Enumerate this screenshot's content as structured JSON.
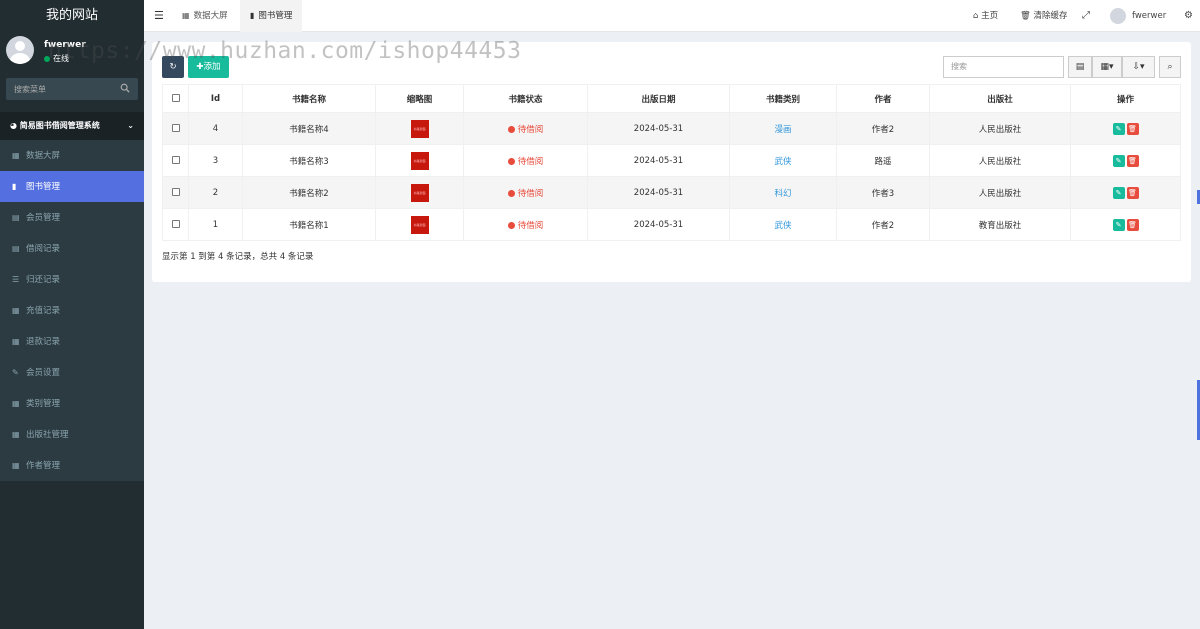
{
  "site": {
    "title": "我的网站"
  },
  "user": {
    "name": "fwerwer",
    "status": "在线"
  },
  "sidebar": {
    "search_placeholder": "搜索菜单",
    "system_name": "简易图书借阅管理系统",
    "items": [
      {
        "label": "数据大屏",
        "icon": "table-icon",
        "active": false
      },
      {
        "label": "图书管理",
        "icon": "book-icon",
        "active": true
      },
      {
        "label": "会员管理",
        "icon": "table-icon",
        "active": false
      },
      {
        "label": "借阅记录",
        "icon": "table-icon",
        "active": false
      },
      {
        "label": "归还记录",
        "icon": "list-icon",
        "active": false
      },
      {
        "label": "充值记录",
        "icon": "table-icon",
        "active": false
      },
      {
        "label": "退款记录",
        "icon": "table-icon",
        "active": false
      },
      {
        "label": "会员设置",
        "icon": "edit-icon",
        "active": false
      },
      {
        "label": "类别管理",
        "icon": "table-icon",
        "active": false
      },
      {
        "label": "出版社管理",
        "icon": "table-icon",
        "active": false
      },
      {
        "label": "作者管理",
        "icon": "table-icon",
        "active": false
      }
    ]
  },
  "topbar": {
    "tabs": [
      {
        "label": "数据大屏",
        "active": false
      },
      {
        "label": "图书管理",
        "active": true
      }
    ],
    "home_label": "主页",
    "clear_cache_label": "清除缓存",
    "username": "fwerwer"
  },
  "toolbar": {
    "add_label": "添加",
    "search_placeholder": "搜索"
  },
  "table": {
    "headers": [
      "Id",
      "书籍名称",
      "缩略图",
      "书籍状态",
      "出版日期",
      "书籍类别",
      "作者",
      "出版社",
      "操作"
    ],
    "cover_text": "书籍封面",
    "rows": [
      {
        "id": "4",
        "name": "书籍名称4",
        "status": "待借阅",
        "date": "2024-05-31",
        "category": "漫画",
        "author": "作者2",
        "publisher": "人民出版社"
      },
      {
        "id": "3",
        "name": "书籍名称3",
        "status": "待借阅",
        "date": "2024-05-31",
        "category": "武侠",
        "author": "路遥",
        "publisher": "人民出版社"
      },
      {
        "id": "2",
        "name": "书籍名称2",
        "status": "待借阅",
        "date": "2024-05-31",
        "category": "科幻",
        "author": "作者3",
        "publisher": "人民出版社"
      },
      {
        "id": "1",
        "name": "书籍名称1",
        "status": "待借阅",
        "date": "2024-05-31",
        "category": "武侠",
        "author": "作者2",
        "publisher": "教育出版社"
      }
    ]
  },
  "pagination": {
    "summary": "显示第 1 到第 4 条记录，总共 4 条记录"
  },
  "watermark": "https://www.huzhan.com/ishop44453",
  "colors": {
    "sidebar_bg": "#222d32",
    "active_menu": "#5470e0",
    "add_button": "#18bc9c",
    "status_red": "#e74c3c",
    "category_blue": "#3498db"
  }
}
